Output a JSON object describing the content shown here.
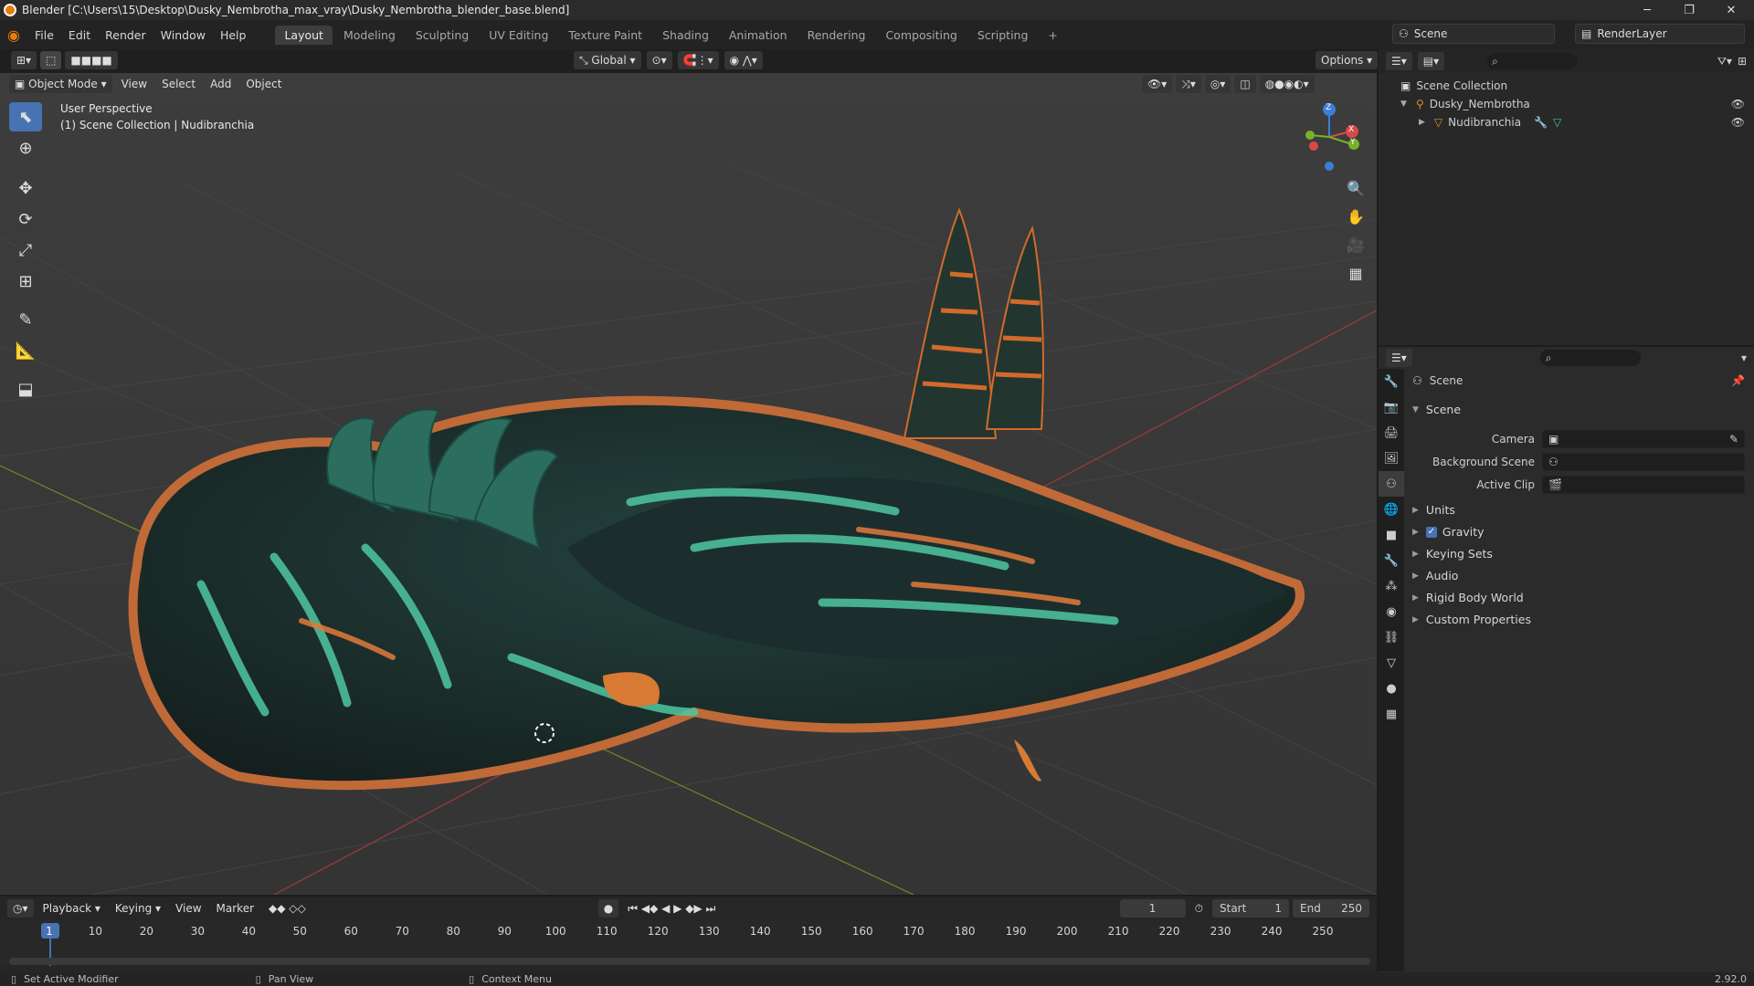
{
  "window": {
    "title": "Blender [C:\\Users\\15\\Desktop\\Dusky_Nembrotha_max_vray\\Dusky_Nembrotha_blender_base.blend]",
    "version": "2.92.0"
  },
  "menu": {
    "items": [
      "File",
      "Edit",
      "Render",
      "Window",
      "Help"
    ]
  },
  "workspaces": {
    "tabs": [
      "Layout",
      "Modeling",
      "Sculpting",
      "UV Editing",
      "Texture Paint",
      "Shading",
      "Animation",
      "Rendering",
      "Compositing",
      "Scripting"
    ],
    "active": "Layout",
    "add_label": "+"
  },
  "top_right": {
    "scene_name": "Scene",
    "render_layer": "RenderLayer"
  },
  "tool_header": {
    "orientation": "Global",
    "options_label": "Options"
  },
  "viewport_header": {
    "mode": "Object Mode",
    "menus": [
      "View",
      "Select",
      "Add",
      "Object"
    ]
  },
  "viewport": {
    "perspective_label": "User Perspective",
    "context_label": "(1) Scene Collection | Nudibranchia"
  },
  "gizmo": {
    "z": "Z",
    "x": "X",
    "y": "Y"
  },
  "outliner": {
    "root": "Scene Collection",
    "items": [
      {
        "name": "Dusky_Nembrotha",
        "level": 1
      },
      {
        "name": "Nudibranchia",
        "level": 2
      }
    ]
  },
  "properties": {
    "context_title": "Scene",
    "panel_title": "Scene",
    "fields": [
      {
        "label": "Camera",
        "value": ""
      },
      {
        "label": "Background Scene",
        "value": ""
      },
      {
        "label": "Active Clip",
        "value": ""
      }
    ],
    "subpanels": [
      "Units",
      "Gravity",
      "Keying Sets",
      "Audio",
      "Rigid Body World",
      "Custom Properties"
    ],
    "gravity_checked": true
  },
  "timeline": {
    "menus": [
      "Playback",
      "Keying",
      "View",
      "Marker"
    ],
    "current_frame": "1",
    "start_label": "Start",
    "start_value": "1",
    "end_label": "End",
    "end_value": "250",
    "ticks": [
      "1",
      "10",
      "20",
      "30",
      "40",
      "50",
      "60",
      "70",
      "80",
      "90",
      "100",
      "110",
      "120",
      "130",
      "140",
      "150",
      "160",
      "170",
      "180",
      "190",
      "200",
      "210",
      "220",
      "230",
      "240",
      "250"
    ]
  },
  "statusbar": {
    "left": "Set Active Modifier",
    "middle": "Pan View",
    "right": "Context Menu"
  },
  "colors": {
    "accent": "#4772b3",
    "active_tab": "#3d3d3d",
    "orange": "#e87d0d"
  }
}
